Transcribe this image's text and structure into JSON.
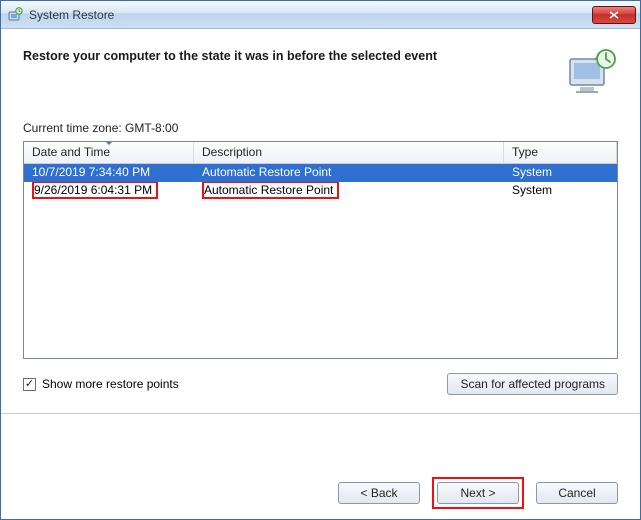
{
  "titlebar": {
    "title": "System Restore"
  },
  "headline": "Restore your computer to the state it was in before the selected event",
  "timezone_label": "Current time zone: GMT-8:00",
  "columns": {
    "datetime": "Date and Time",
    "description": "Description",
    "type": "Type"
  },
  "rows": [
    {
      "datetime": "10/7/2019 7:34:40 PM",
      "description": "Automatic Restore Point",
      "type": "System",
      "selected": true
    },
    {
      "datetime": "9/26/2019 6:04:31 PM",
      "description": "Automatic Restore Point",
      "type": "System",
      "selected": false
    }
  ],
  "checkbox": {
    "checked": true,
    "label": "Show more restore points"
  },
  "buttons": {
    "scan": "Scan for affected programs",
    "back": "< Back",
    "next": "Next >",
    "cancel": "Cancel"
  }
}
